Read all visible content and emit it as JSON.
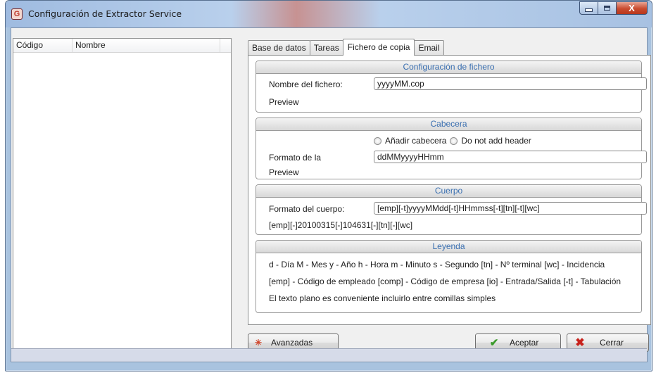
{
  "window": {
    "title": "Configuración de Extractor Service",
    "close_symbol": "X"
  },
  "icons": {
    "app": "app-logo-icon",
    "advanced": "asterisk-icon",
    "accept": "checkmark-icon",
    "close": "red-x-icon"
  },
  "list": {
    "columns": [
      "Código",
      "Nombre"
    ]
  },
  "tabs": [
    "Base de datos",
    "Tareas",
    "Fichero de copia",
    "Email"
  ],
  "active_tab": "Fichero de copia",
  "file_group": {
    "title": "Configuración de fichero",
    "name_label": "Nombre del fichero:",
    "name_value": "yyyyMM.cop",
    "preview_label": "Preview"
  },
  "header_group": {
    "title": "Cabecera",
    "radio_add": "Añadir cabecera",
    "radio_no": "Do not add header",
    "format_label": "Formato de la",
    "format_value": "ddMMyyyyHHmm",
    "preview_label": "Preview"
  },
  "body_group": {
    "title": "Cuerpo",
    "format_label": "Formato del cuerpo:",
    "format_value": "[emp][-t]yyyyMMdd[-t]HHmmss[-t][tn][-t][wc]",
    "preview_value": "[emp][-]20100315[-]104631[-][tn][-][wc]"
  },
  "legend_group": {
    "title": "Leyenda",
    "lines": [
      "d - Día   M - Mes  y - Año  h - Hora  m - Minuto  s - Segundo  [tn] - Nº terminal  [wc] - Incidencia",
      "[emp] - Código de empleado  [comp] - Código de empresa  [io] - Entrada/Salida  [-t] - Tabulación",
      "El texto plano es conveniente incluirlo entre comillas simples"
    ]
  },
  "buttons": {
    "advanced": "Avanzadas",
    "accept": "Aceptar",
    "close": "Cerrar"
  },
  "colors": {
    "group_title": "#3a6fb0",
    "accept_icon": "#3a9a2a",
    "close_icon": "#c8231d",
    "advanced_icon": "#d0452a"
  }
}
